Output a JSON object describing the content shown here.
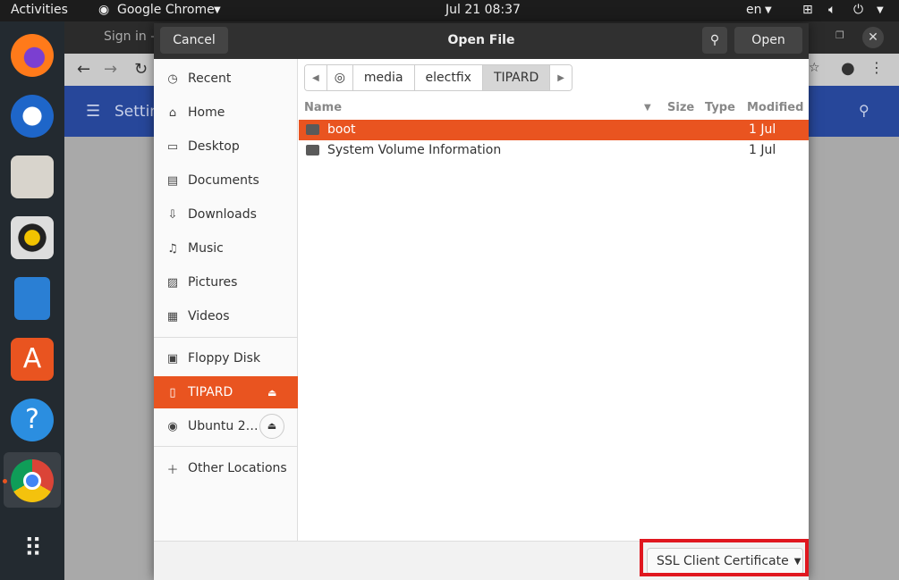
{
  "topbar": {
    "activities": "Activities",
    "app": "Google Chrome",
    "clock": "Jul 21  08:37",
    "lang": "en"
  },
  "dock": {
    "apps": [
      "firefox",
      "thunderbird",
      "files",
      "rhythmbox",
      "libreoffice-writer",
      "ubuntu-software",
      "help",
      "google-chrome",
      "show-applications"
    ]
  },
  "chrome": {
    "tab_title": "Sign in –",
    "page_title": "Settin"
  },
  "dialog": {
    "title": "Open File",
    "cancel": "Cancel",
    "open": "Open",
    "sidebar": {
      "places": [
        "Recent",
        "Home",
        "Desktop",
        "Documents",
        "Downloads",
        "Music",
        "Pictures",
        "Videos"
      ],
      "devices": [
        "Floppy Disk",
        "TIPARD",
        "Ubuntu 2…"
      ],
      "other": "Other Locations"
    },
    "path": [
      "media",
      "electfix",
      "TIPARD"
    ],
    "columns": {
      "name": "Name",
      "size": "Size",
      "type": "Type",
      "modified": "Modified"
    },
    "files": [
      {
        "name": "boot",
        "modified": "1 Jul",
        "selected": true
      },
      {
        "name": "System Volume Information",
        "modified": "1 Jul",
        "selected": false
      }
    ],
    "filter": "SSL Client Certificate"
  },
  "colors": {
    "accent": "#e95420",
    "highlight": "#e0171f"
  }
}
